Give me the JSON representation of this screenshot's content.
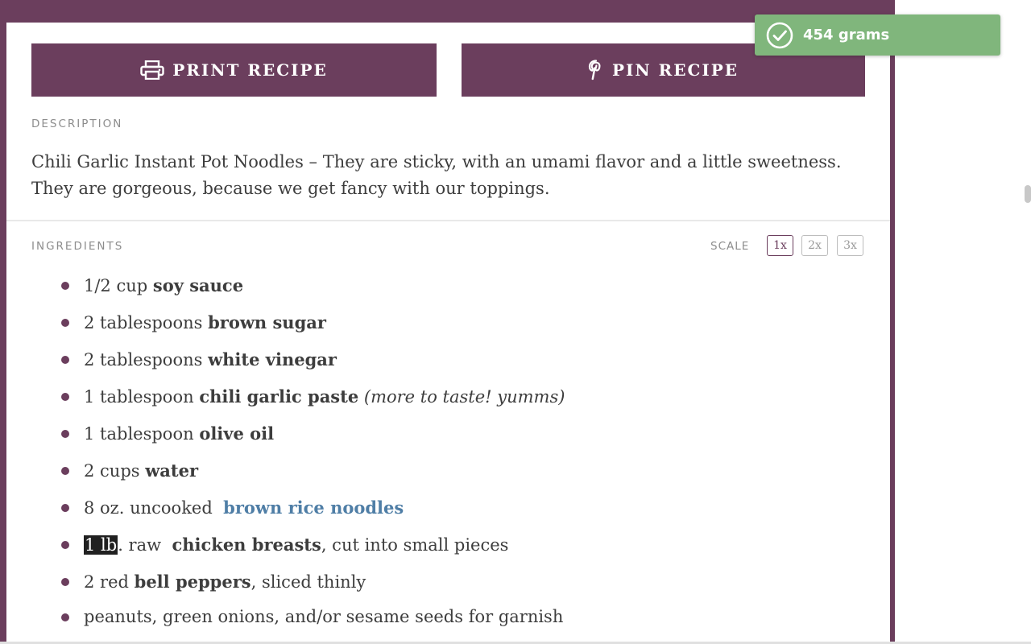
{
  "buttons": {
    "print_label": "PRINT RECIPE",
    "pin_label": "PIN RECIPE"
  },
  "description": {
    "label": "DESCRIPTION",
    "text": "Chili Garlic Instant Pot Noodles – They are sticky, with an umami flavor and a little sweetness. They are gorgeous, because we get fancy with our toppings."
  },
  "ingredients": {
    "label": "INGREDIENTS",
    "scale_label": "SCALE",
    "scale_options": [
      "1x",
      "2x",
      "3x"
    ],
    "selected_scale": "1x",
    "items": [
      {
        "amount": "1/2 cup",
        "name": "soy sauce"
      },
      {
        "amount": "2 tablespoons",
        "name": "brown sugar"
      },
      {
        "amount": "2 tablespoons",
        "name": "white vinegar"
      },
      {
        "amount": "1 tablespoon",
        "name": "chili garlic paste",
        "note": "(more to taste! yumms)"
      },
      {
        "amount": "1 tablespoon",
        "name": "olive oil"
      },
      {
        "amount": "2 cups",
        "name": "water"
      },
      {
        "amount": "8 oz. uncooked",
        "link": "brown rice noodles"
      },
      {
        "amount_highlight": "1 lb",
        "amount_rest": ". raw",
        "name": "chicken breasts",
        "suffix": ", cut into small pieces"
      },
      {
        "amount": "2 red",
        "name": "bell peppers",
        "suffix": ", sliced thinly"
      },
      {
        "text": "peanuts, green onions, and/or sesame seeds for garnish"
      }
    ]
  },
  "toast": {
    "text": "454 grams",
    "icon": "check-circle-icon"
  },
  "colors": {
    "brand": "#6b3e5d",
    "link": "#4f7ea6",
    "toast": "#80b67c",
    "text": "#3d3d3d"
  }
}
